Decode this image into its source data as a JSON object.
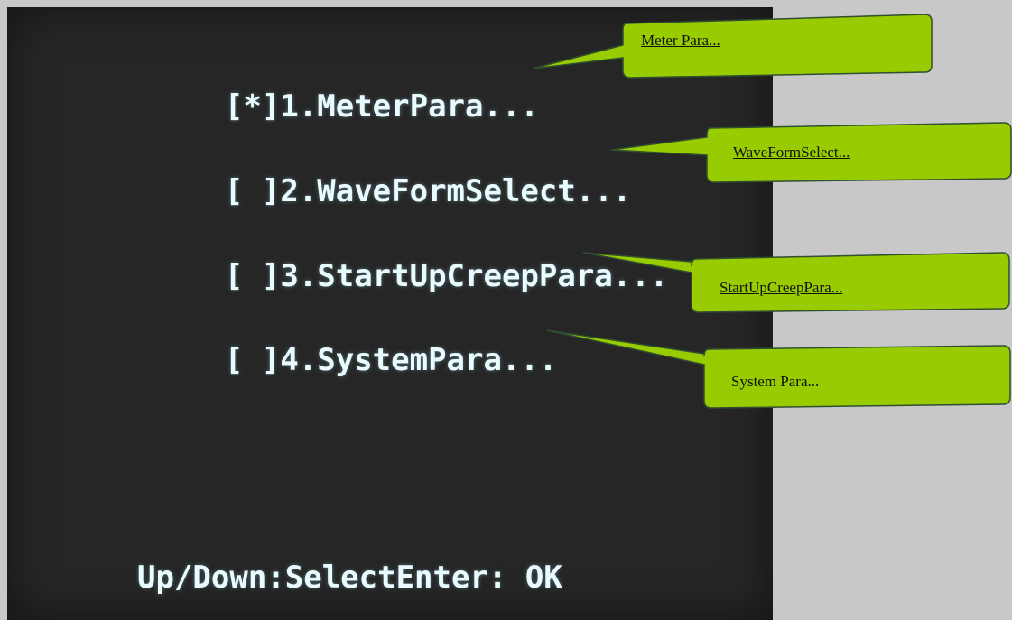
{
  "menu": {
    "items": [
      {
        "marker": "[*]",
        "text": "1.MeterPara..."
      },
      {
        "marker": "[ ]",
        "text": "2.WaveFormSelect..."
      },
      {
        "marker": "[ ]",
        "text": "3.StartUpCreepPara..."
      },
      {
        "marker": "[ ]",
        "text": "4.SystemPara..."
      }
    ],
    "footer": "Up/Down:SelectEnter: OK"
  },
  "callouts": [
    {
      "label": "Meter Para..."
    },
    {
      "label": "WaveFormSelect..."
    },
    {
      "label": "StartUpCreepPara..."
    },
    {
      "label": "System Para..."
    }
  ],
  "colors": {
    "screen_background": "#262626",
    "screen_text": "#e8fbff",
    "callout_fill": "#99cc00",
    "callout_border": "#2f4f2f",
    "page_background": "#c8c8c8"
  }
}
